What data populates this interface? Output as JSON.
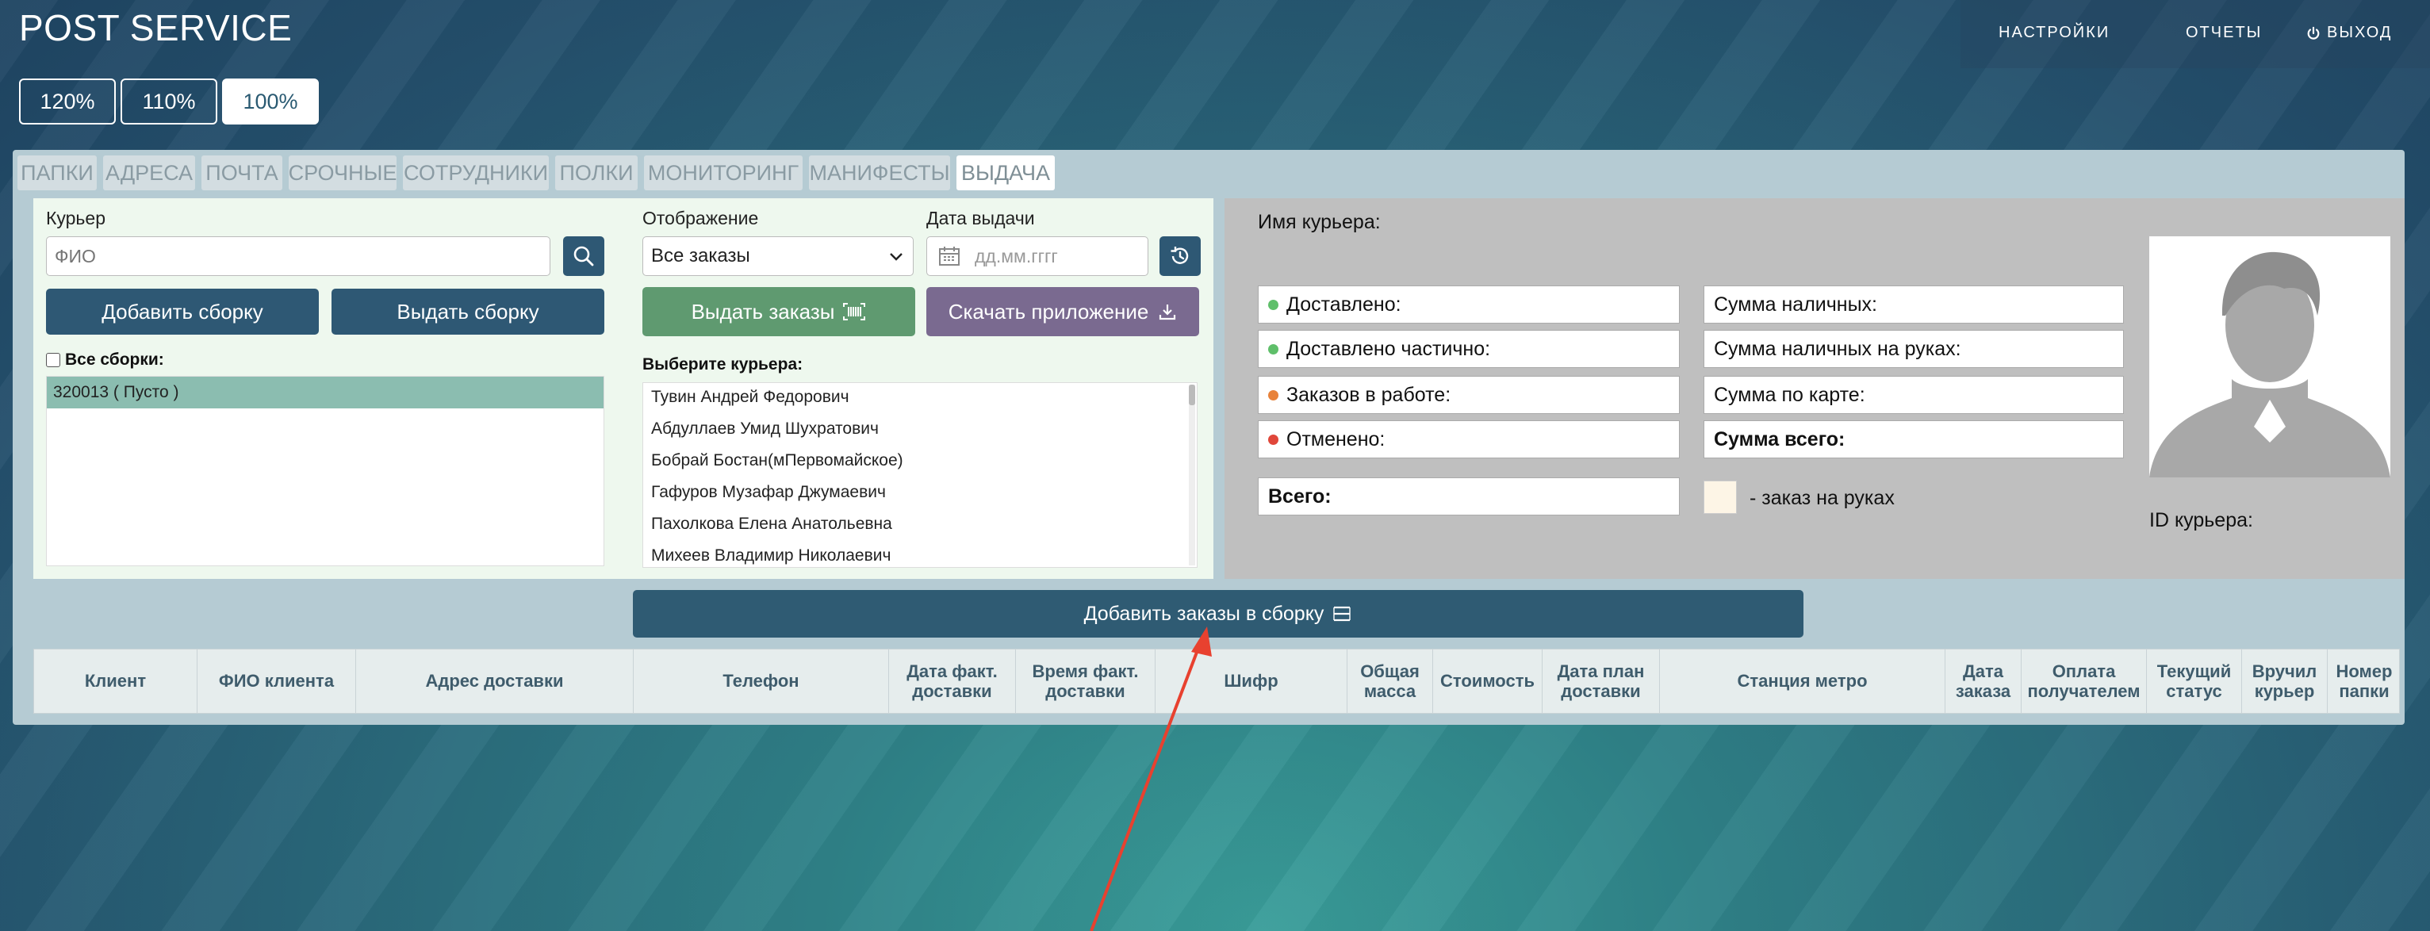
{
  "app": {
    "title": "POST SERVICE"
  },
  "top_nav": {
    "settings": "НАСТРОЙКИ",
    "reports": "ОТЧЕТЫ",
    "logout": "ВЫХОД"
  },
  "zoom": {
    "z120": "120%",
    "z110": "110%",
    "z100": "100%"
  },
  "tabs": [
    "ПАПКИ",
    "АДРЕСА",
    "ПОЧТА",
    "СРОЧНЫЕ",
    "СОТРУДНИКИ",
    "ПОЛКИ",
    "МОНИТОРИНГ",
    "МАНИФЕСТЫ",
    "ВЫДАЧА"
  ],
  "left": {
    "courier_label": "Курьер",
    "courier_placeholder": "ФИО",
    "add_build": "Добавить сборку",
    "issue_build": "Выдать сборку",
    "all_builds_label": "Все сборки:",
    "builds": [
      "320013 ( Пусто )"
    ],
    "display_label": "Отображение",
    "display_value": "Все заказы",
    "date_label": "Дата выдачи",
    "date_placeholder": "дд.мм.гггг",
    "issue_orders": "Выдать заказы",
    "download_app": "Скачать приложение",
    "choose_courier": "Выберите курьера:",
    "couriers": [
      "Тувин Андрей Федорович",
      "Абдуллаев Умид Шухратович",
      "Бобрай Бостан(мПервомайское)",
      "Гафуров Музафар Джумаевич",
      "Пахолкова Елена Анатольевна",
      "Михеев Владимир Николаевич"
    ]
  },
  "right": {
    "courier_name_label": "Имя курьера:",
    "delivered": "Доставлено:",
    "partially": "Доставлено частично:",
    "in_work": "Заказов в работе:",
    "cancelled": "Отменено:",
    "total": "Всего:",
    "cash_sum": "Сумма наличных:",
    "cash_in_hand": "Сумма наличных на руках:",
    "card_sum": "Сумма по карте:",
    "sum_total": "Сумма всего:",
    "legend_in_hand": "- заказ на руках",
    "courier_id_label": "ID курьера:",
    "colors": {
      "green": "#5fbf6a",
      "orange": "#e8823a",
      "red": "#e0473a"
    }
  },
  "add_orders_button": "Добавить заказы в сборку",
  "table": {
    "headers": [
      "Клиент",
      "ФИО клиента",
      "Адрес доставки",
      "Телефон",
      "Дата факт. доставки",
      "Время факт. доставки",
      "Шифр",
      "Общая масса",
      "Стоимость",
      "Дата план доставки",
      "Станция метро",
      "Дата заказа",
      "Оплата получателем",
      "Текущий статус",
      "Вручил курьер",
      "Номер папки"
    ]
  }
}
